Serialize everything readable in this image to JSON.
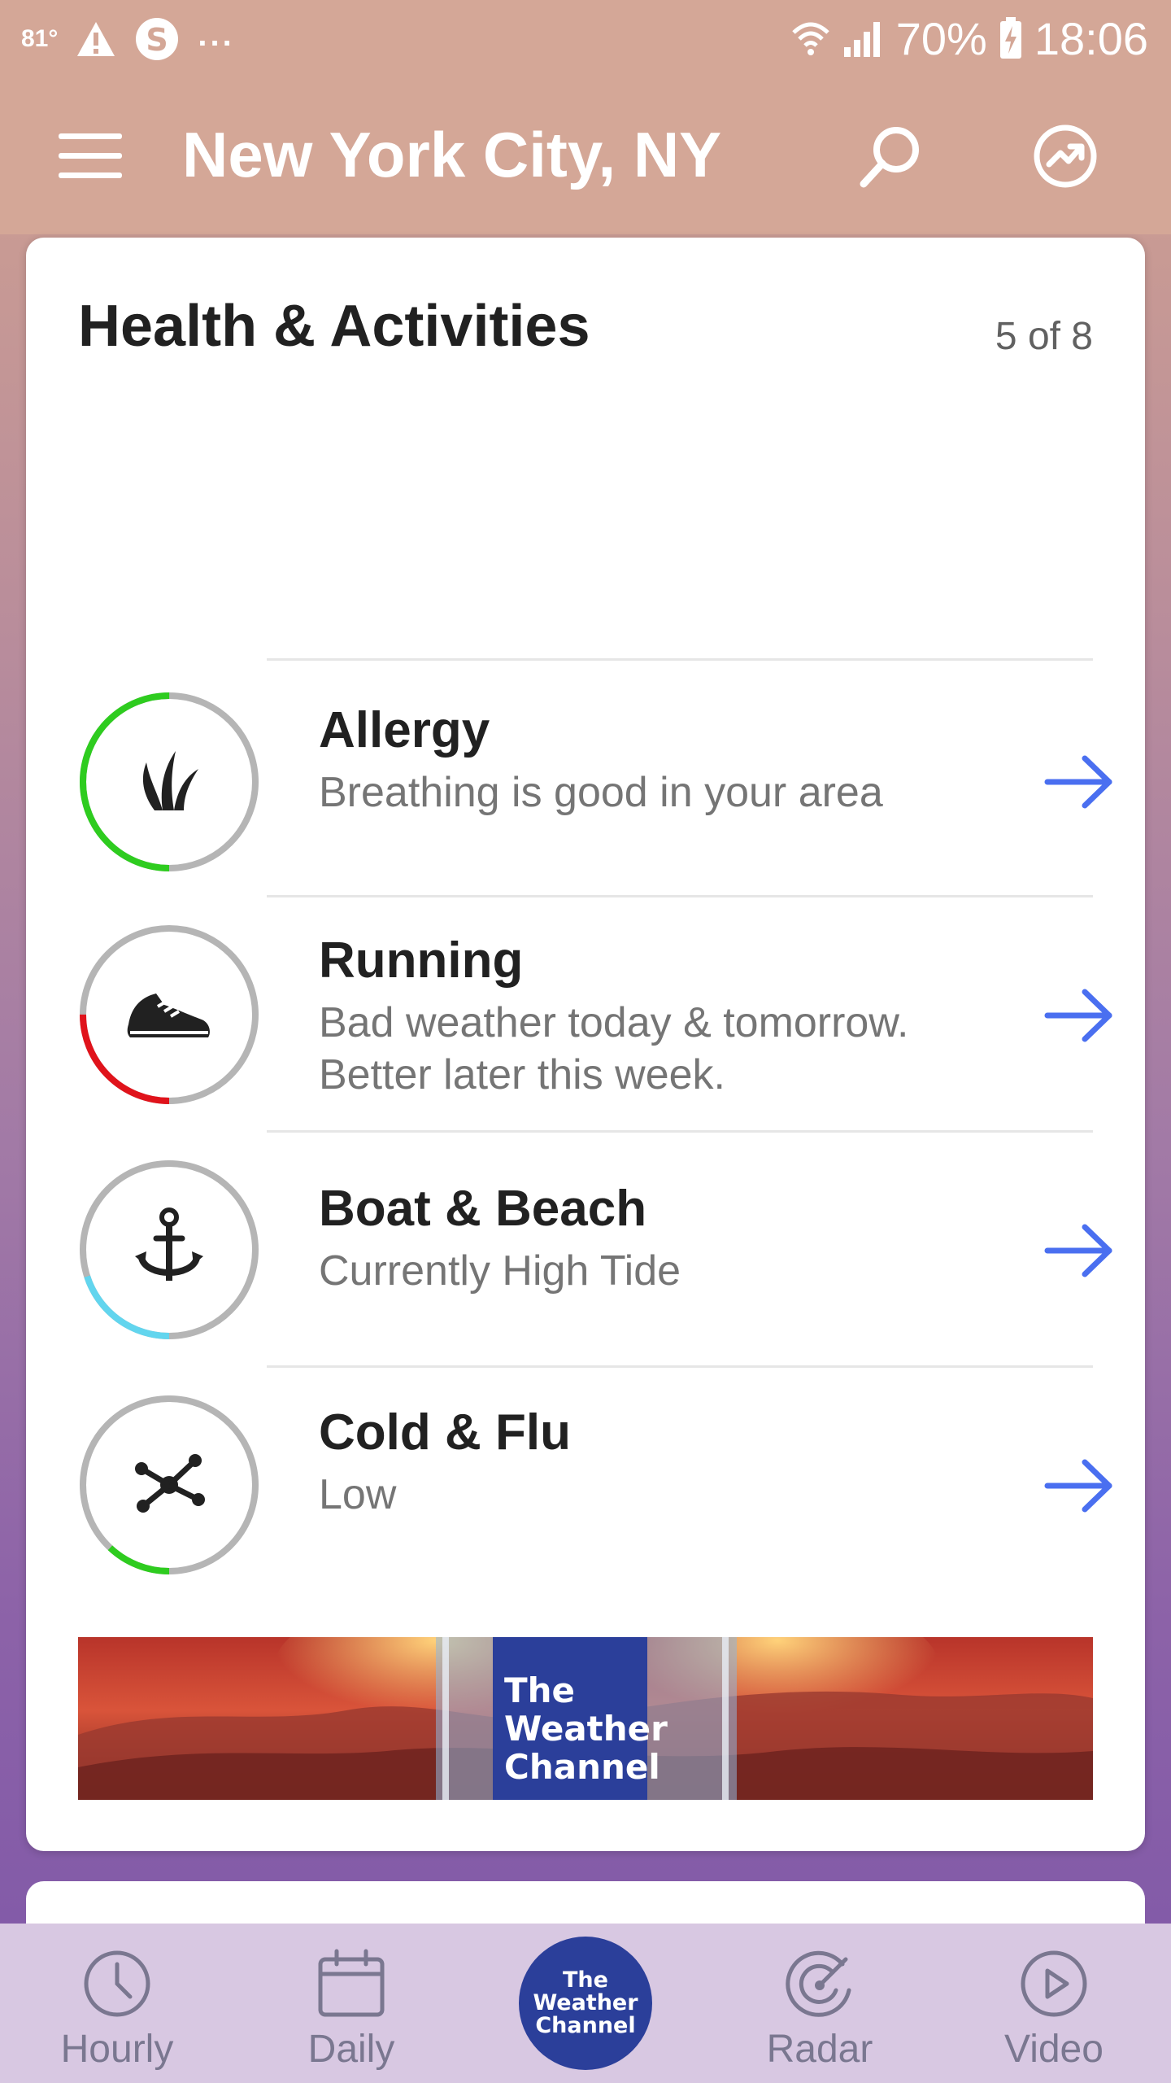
{
  "status_bar": {
    "temperature": "81°",
    "more": "...",
    "battery": "70%",
    "time": "18:06"
  },
  "app_bar": {
    "location": "New York City, NY"
  },
  "card": {
    "title": "Health & Activities",
    "count": "5 of 8",
    "items": [
      {
        "title": "Allergy",
        "description": "Breathing is good in your area",
        "icon": "grass-icon",
        "level_color": "#2ecc1f",
        "level": 0.5
      },
      {
        "title": "Running",
        "description": "Bad weather today & tomorrow. Better later this week.",
        "icon": "running-shoe-icon",
        "level_color": "#e0131b",
        "level": 0.25
      },
      {
        "title": "Boat & Beach",
        "description": "Currently High Tide",
        "icon": "anchor-icon",
        "level_color": "#62d5ee",
        "level": 0.2
      },
      {
        "title": "Cold & Flu",
        "description": "Low",
        "icon": "virus-icon",
        "level_color": "#2ecc1f",
        "level": 0.12
      }
    ],
    "arrow_color": "#4a6ff0",
    "ring_track_color": "#b5b5b5"
  },
  "banner": {
    "logo_lines": [
      "The",
      "Weather",
      "Channel"
    ]
  },
  "bottom_nav": {
    "items": [
      {
        "label": "Hourly",
        "icon": "clock-icon"
      },
      {
        "label": "Daily",
        "icon": "calendar-icon"
      },
      {
        "label": "Radar",
        "icon": "radar-icon"
      },
      {
        "label": "Video",
        "icon": "play-icon"
      }
    ],
    "center_logo_lines": [
      "The",
      "Weather",
      "Channel"
    ]
  },
  "colors": {
    "header": "#d4a797",
    "nav_background": "#d8c8e2",
    "brand_blue": "#2b3f9a"
  }
}
